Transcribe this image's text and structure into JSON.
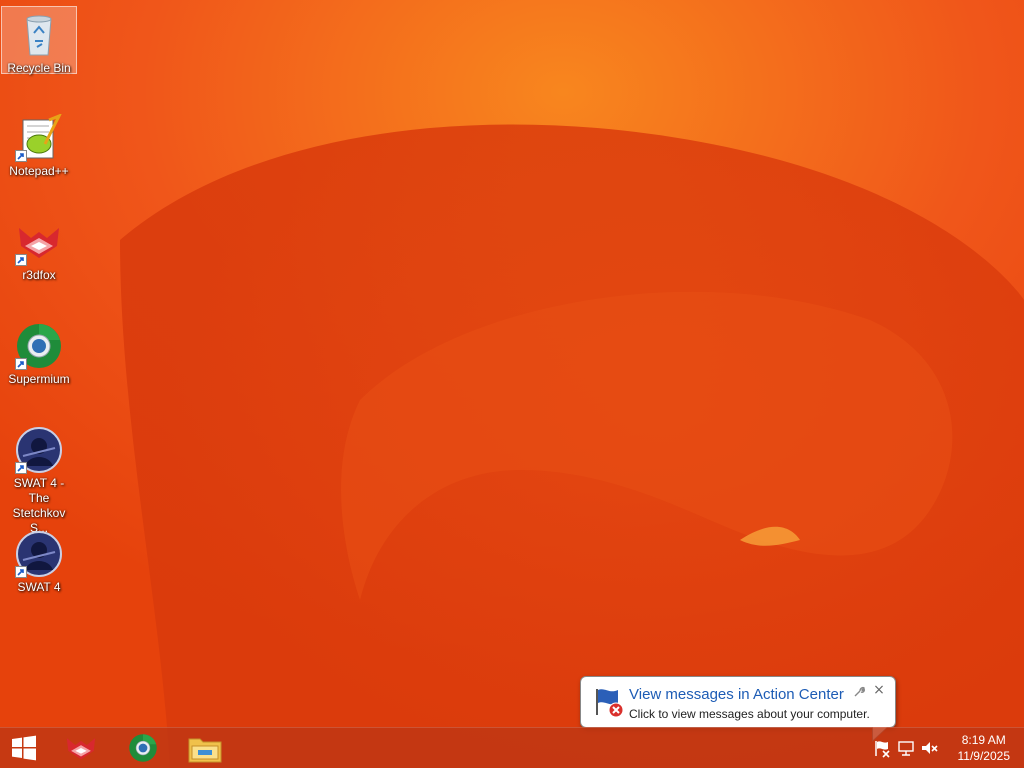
{
  "desktop": {
    "icons": [
      {
        "label": "Recycle Bin",
        "icon": "recycle-bin-icon",
        "selected": true
      },
      {
        "label": "Notepad++",
        "icon": "notepad-plus-plus-icon",
        "shortcut": true
      },
      {
        "label": "r3dfox",
        "icon": "r3dfox-icon",
        "shortcut": true
      },
      {
        "label": "Supermium",
        "icon": "supermium-icon",
        "shortcut": true
      },
      {
        "label": "SWAT 4 - The Stetchkov S...",
        "icon": "swat4-expansion-icon",
        "shortcut": true
      },
      {
        "label": "SWAT 4",
        "icon": "swat4-icon",
        "shortcut": true
      }
    ]
  },
  "taskbar": {
    "start": "windows-start-icon",
    "pinned": [
      {
        "name": "r3dfox",
        "icon": "r3dfox-icon"
      },
      {
        "name": "Supermium",
        "icon": "supermium-icon"
      },
      {
        "name": "File Explorer",
        "icon": "file-explorer-icon"
      }
    ],
    "tray": [
      "action-center-flag-icon",
      "network-icon",
      "volume-muted-icon"
    ],
    "clock": {
      "time": "8:19 AM",
      "date": "11/9/2025"
    }
  },
  "notification": {
    "title": "View messages in Action Center",
    "body": "Click to view messages about your computer.",
    "close": "×"
  },
  "colors": {
    "wallpaper_base": "#e8420a",
    "wallpaper_light": "#f57a1a",
    "taskbar": "#be3714",
    "balloon_title": "#1d5cb5"
  }
}
